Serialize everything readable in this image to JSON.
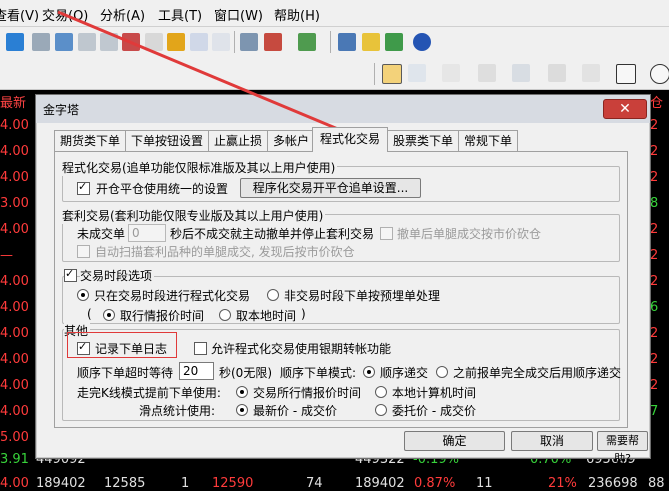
{
  "menubar": {
    "items": [
      "查看(V)",
      "交易(O)",
      "分析(A)",
      "工具(T)",
      "窗口(W)",
      "帮助(H)"
    ]
  },
  "background": {
    "left_header": "最新",
    "left_values": [
      "4.00",
      "4.00",
      "4.00",
      "3.00",
      "4.00",
      "—",
      "4.00",
      "4.00",
      "4.00",
      "4.00",
      "4.00",
      "4.00",
      "5.00",
      "5.00"
    ],
    "right_header": "仓",
    "right_values": [
      "2",
      "2",
      "2",
      "8",
      "2",
      "2",
      "2",
      "6",
      "2",
      "2",
      "2",
      "7",
      "2",
      "2"
    ],
    "bottom_row1": [
      "3.91",
      "449092",
      "",
      "",
      "",
      "",
      "449322",
      "-0.19%",
      "",
      "0.70%",
      "695689",
      ""
    ],
    "bottom_row2": [
      "4.00",
      "189402",
      "12585",
      "1",
      "12590",
      "74",
      "189402",
      "0.87%",
      "11",
      "21%",
      "236698",
      "88"
    ]
  },
  "dialog": {
    "title": "金字塔",
    "close_label": "✕",
    "tabs": [
      "期货类下单",
      "下单按钮设置",
      "止赢止损",
      "多帐户",
      "程式化交易",
      "股票类下单",
      "常规下单"
    ],
    "active_tab": 4,
    "prog": {
      "group_label": "程式化交易(追单功能仅限标准版及其以上用户使用)",
      "unified_label": "开仓平仓使用统一的设置",
      "unified_checked": true,
      "settings_button": "程序化交易开平仓追单设置..."
    },
    "arb": {
      "group_label": "套利交易(套利功能仅限专业版及其以上用户使用)",
      "unfilled_prefix": "未成交单",
      "unfilled_value": "0",
      "unfilled_suffix": "秒后不成交就主动撤单并停止套利交易",
      "cancel_label": "撤单后单腿成交按市价砍仓",
      "scan_label": "自动扫描套利品种的单腿成交, 发现后按市价砍仓"
    },
    "session": {
      "check_label": "交易时段选项",
      "checked": true,
      "opt1": "只在交易时段进行程式化交易",
      "opt2": "非交易时段下单按预埋单处理",
      "sub_prefix": "(",
      "sub1": "取行情报价时间",
      "sub2": "取本地时间",
      "sub_suffix": ")"
    },
    "other": {
      "group_label": "其他",
      "log_label": "记录下单日志",
      "log_checked": true,
      "bank_label": "允许程式化交易使用银期转帐功能",
      "bank_checked": false,
      "timeout_prefix": "顺序下单超时等待",
      "timeout_value": "20",
      "timeout_suffix": "秒(0无限)",
      "mode_label": "顺序下单模式:",
      "mode1": "顺序递交",
      "mode2": "之前报单完全成交后用顺序递交",
      "complete_label": "走完K线模式提前下单使用:",
      "complete1": "交易所行情报价时间",
      "complete2": "本地计算机时间",
      "slip_label": "滑点统计使用:",
      "slip1": "最新价 - 成交价",
      "slip2": "委托价 - 成交价"
    },
    "buttons": {
      "ok": "确定",
      "cancel": "取消",
      "help": "需要帮助?"
    }
  },
  "colors": {
    "annotation": "#e03a3a",
    "up": "#ff3b3b",
    "down": "#37d23a"
  }
}
